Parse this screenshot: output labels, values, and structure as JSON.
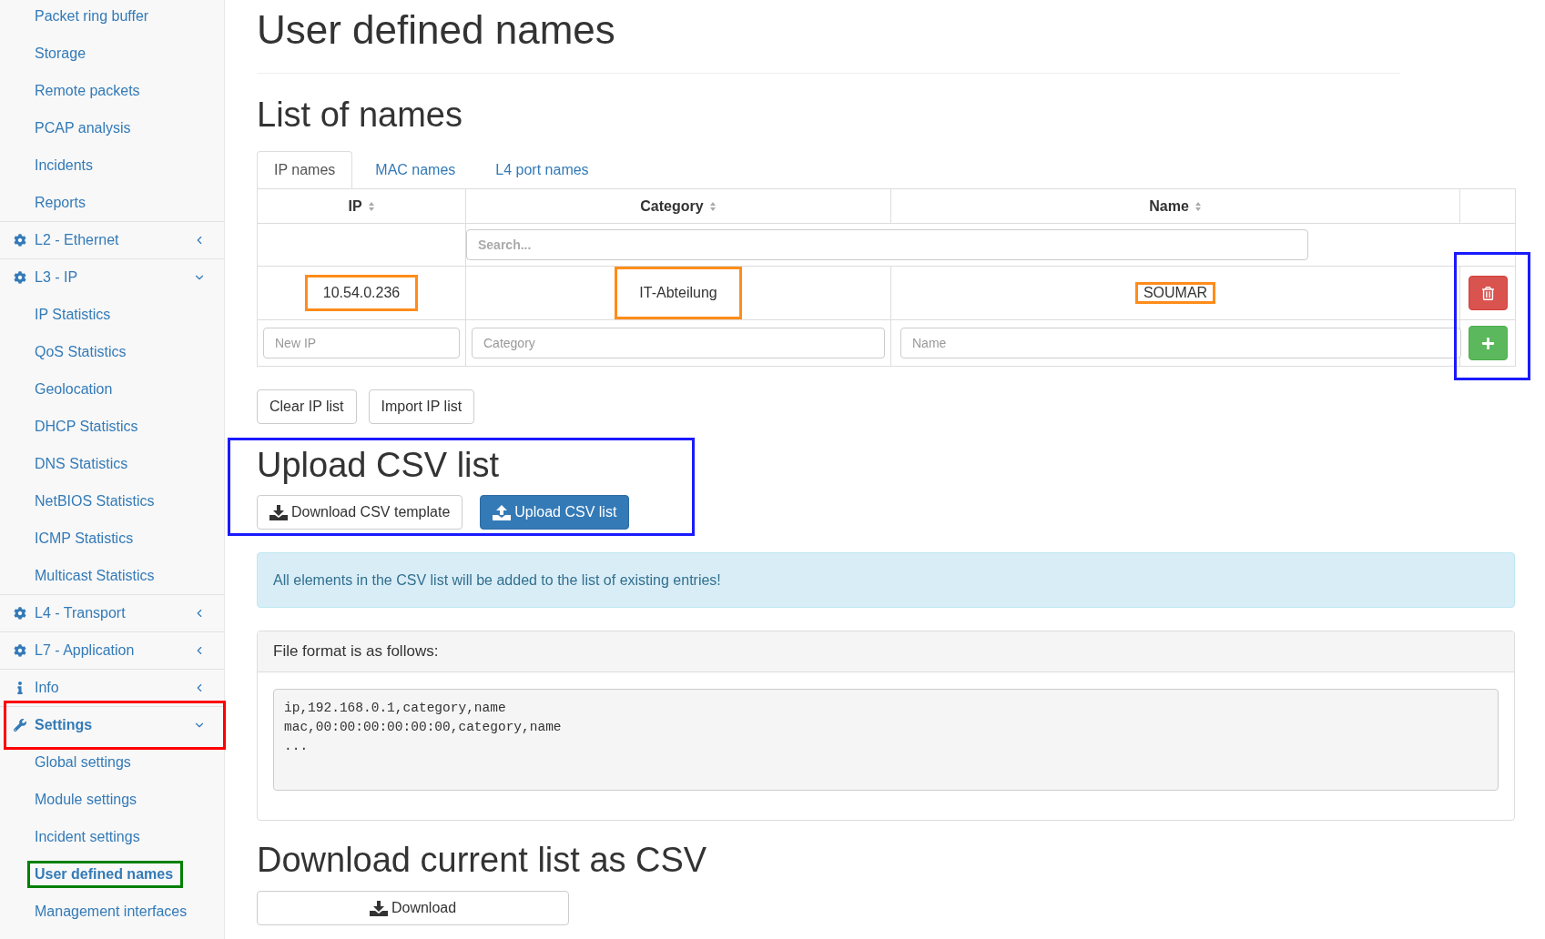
{
  "sidebar": {
    "items": [
      {
        "kind": "link",
        "label": "Packet ring buffer",
        "selected": false
      },
      {
        "kind": "link",
        "label": "Storage",
        "selected": false
      },
      {
        "kind": "link",
        "label": "Remote packets",
        "selected": false
      },
      {
        "kind": "link",
        "label": "PCAP analysis",
        "selected": false
      },
      {
        "kind": "link",
        "label": "Incidents",
        "selected": false
      },
      {
        "kind": "link",
        "label": "Reports",
        "selected": false
      },
      {
        "kind": "group",
        "label": "L2 - Ethernet",
        "expanded": false,
        "active": false
      },
      {
        "kind": "group",
        "label": "L3 - IP",
        "expanded": true,
        "active": false,
        "children": [
          {
            "label": "IP Statistics",
            "selected": false
          },
          {
            "label": "QoS Statistics",
            "selected": false
          },
          {
            "label": "Geolocation",
            "selected": false
          },
          {
            "label": "DHCP Statistics",
            "selected": false
          },
          {
            "label": "DNS Statistics",
            "selected": false
          },
          {
            "label": "NetBIOS Statistics",
            "selected": false
          },
          {
            "label": "ICMP Statistics",
            "selected": false
          },
          {
            "label": "Multicast Statistics",
            "selected": false
          }
        ]
      },
      {
        "kind": "group",
        "label": "L4 - Transport",
        "expanded": false,
        "active": false
      },
      {
        "kind": "group",
        "label": "L7 - Application",
        "expanded": false,
        "active": false
      },
      {
        "kind": "group",
        "label": "Info",
        "expanded": false,
        "active": false
      },
      {
        "kind": "group",
        "label": "Settings",
        "expanded": true,
        "active": true,
        "highlight": {
          "color": "#ff0000"
        },
        "children": [
          {
            "label": "Global settings",
            "selected": false
          },
          {
            "label": "Module settings",
            "selected": false
          },
          {
            "label": "Incident settings",
            "selected": false
          },
          {
            "label": "User defined names",
            "selected": true,
            "highlight": {
              "color": "#008000"
            }
          },
          {
            "label": "Management interfaces",
            "selected": false
          }
        ]
      }
    ]
  },
  "page_title": "User defined names",
  "list_section": {
    "heading": "List of names",
    "tabs": [
      {
        "label": "IP names",
        "selected": true
      },
      {
        "label": "MAC names",
        "selected": false
      },
      {
        "label": "L4 port names",
        "selected": false
      }
    ],
    "table": {
      "columns": [
        "IP",
        "Category",
        "Name"
      ],
      "search_placeholder": "Search...",
      "rows": [
        {
          "cells": [
            {
              "text": "10.54.0.236",
              "highlight": {
                "color": "#ff8c1a"
              }
            },
            {
              "text": "IT-Abteilung",
              "highlight": {
                "color": "#ff8c1a"
              }
            },
            {
              "text": "SOUMAR",
              "highlight": {
                "color": "#ff8c1a"
              }
            }
          ]
        }
      ],
      "new_row_placeholders": [
        "New IP",
        "Category",
        "Name"
      ],
      "actions_highlight": {
        "color": "#1a1aff"
      }
    },
    "buttons": [
      "Clear IP list",
      "Import IP list"
    ]
  },
  "upload_section": {
    "heading": "Upload CSV list",
    "highlight": {
      "color": "#1a1aff"
    },
    "buttons": [
      {
        "kind": "download",
        "label": "Download CSV template"
      },
      {
        "kind": "upload",
        "label": "Upload CSV list"
      }
    ]
  },
  "alert": "All elements in the CSV list will be added to the list of existing entries!",
  "format_panel": {
    "heading": "File format is as follows:",
    "lines": [
      "ip,192.168.0.1,category,name",
      "mac,00:00:00:00:00:00,category,name",
      "..."
    ]
  },
  "download_section": {
    "heading": "Download current list as CSV",
    "button": "Download"
  }
}
